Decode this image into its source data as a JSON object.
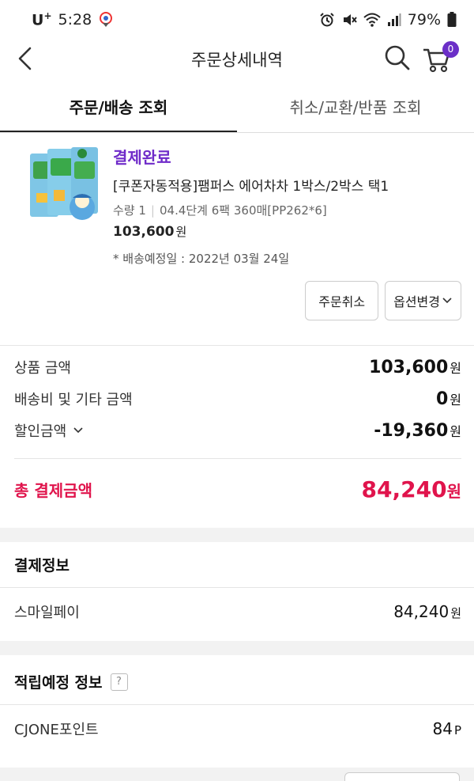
{
  "status_bar": {
    "carrier": "U",
    "carrier_sup": "+",
    "time": "5:28",
    "battery": "79%"
  },
  "header": {
    "title": "주문상세내역",
    "cart_count": "0"
  },
  "tabs": [
    {
      "label": "주문/배송 조회",
      "active": true
    },
    {
      "label": "취소/교환/반품 조회",
      "active": false
    }
  ],
  "order": {
    "status": "결제완료",
    "product_name": "[쿠폰자동적용]팸퍼스 에어차차 1박스/2박스 택1",
    "quantity": "수량 1",
    "option": "04.4단계 6팩 360매[PP262*6]",
    "price": "103,600",
    "price_unit": "원",
    "delivery_date": "* 배송예정일 : 2022년 03월 24일",
    "cancel_button": "주문취소",
    "option_button": "옵션변경"
  },
  "summary": {
    "product_amount_label": "상품 금액",
    "product_amount": "103,600",
    "shipping_label": "배송비 및 기타 금액",
    "shipping_amount": "0",
    "discount_label": "할인금액",
    "discount_amount": "-19,360",
    "won": "원",
    "total_label": "총 결제금액",
    "total_amount": "84,240",
    "accent_color": "#e0144c"
  },
  "payment_info": {
    "title": "결제정보",
    "method": "스마일페이",
    "amount": "84,240",
    "unit": "원"
  },
  "points_info": {
    "title": "적립예정 정보",
    "help": "?",
    "point_label": "CJONE포인트",
    "point_value": "84",
    "point_unit": "P"
  },
  "colors": {
    "status_purple": "#6f2bc9",
    "badge_purple": "#6b2fc7",
    "total_red": "#e0144c"
  }
}
